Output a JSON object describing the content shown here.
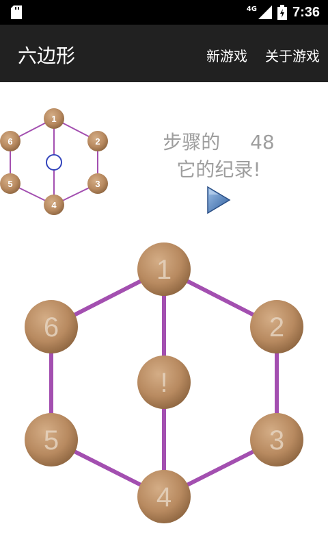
{
  "status_bar": {
    "network": "4G",
    "time": "7:36"
  },
  "action_bar": {
    "title": "六边形",
    "menu": [
      "新游戏",
      "关于游戏"
    ]
  },
  "mini_board": {
    "nodes": [
      "1",
      "2",
      "3",
      "4",
      "5",
      "6"
    ],
    "center_marker": "circle"
  },
  "info": {
    "steps_label": "步骤的",
    "steps_value": "48",
    "record_text": "它的纪录!"
  },
  "board": {
    "nodes": [
      "1",
      "2",
      "3",
      "4",
      "5",
      "6"
    ],
    "center_label": "!"
  },
  "colors": {
    "line": "#a34fb0",
    "wood": "#b88a60",
    "play": "#3c6fb0",
    "marker": "#3344bb"
  }
}
